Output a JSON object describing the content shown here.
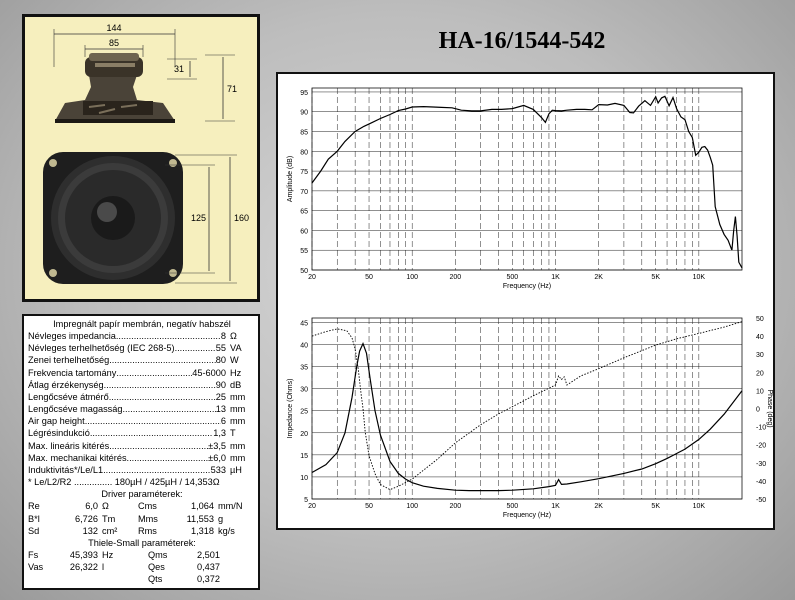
{
  "model": "HA-16/1544-542",
  "drawing": {
    "dim_144": "144",
    "dim_85": "85",
    "dim_31": "31",
    "dim_71": "71",
    "dim_125": "125",
    "dim_160": "160"
  },
  "specs": {
    "title": "Impregnált papír membrán, negatív habszél",
    "rows": [
      {
        "label": "Névleges impedancia",
        "value": "8",
        "unit": "Ω"
      },
      {
        "label": "Névleges terhelhetőség (IEC 268-5)",
        "value": "55",
        "unit": "VA"
      },
      {
        "label": "Zenei terhelhetőség",
        "value": "80",
        "unit": "W"
      },
      {
        "label": "Frekvencia tartomány",
        "value": "45-6000",
        "unit": "Hz"
      },
      {
        "label": "Átlag érzékenység",
        "value": "90",
        "unit": "dB"
      },
      {
        "label": "Lengőcséve átmérő",
        "value": "25",
        "unit": "mm"
      },
      {
        "label": "Lengőcséve magasság",
        "value": "13",
        "unit": "mm"
      },
      {
        "label": "Air gap height",
        "value": "6",
        "unit": "mm"
      },
      {
        "label": "Légrésindukció",
        "value": "1,3",
        "unit": "T"
      },
      {
        "label": "Max. lineáris kitérés",
        "value": "±3,5",
        "unit": "mm"
      },
      {
        "label": "Max. mechanikai kitérés",
        "value": "±6,0",
        "unit": "mm"
      },
      {
        "label": "Induktivitás*/Le/L1",
        "value": "533",
        "unit": "µH"
      }
    ],
    "le_note": "* Le/L2/R2 ............... 180µH / 425µH / 14,353Ω",
    "driver_title": "Driver paraméterek:",
    "driver_rows": [
      {
        "a_label": "Re",
        "a_value": "6,0",
        "a_unit": "Ω",
        "b_label": "Cms",
        "b_value": "1,064",
        "b_unit": "mm/N"
      },
      {
        "a_label": "B*l",
        "a_value": "6,726",
        "a_unit": "Tm",
        "b_label": "Mms",
        "b_value": "11,553",
        "b_unit": "g"
      },
      {
        "a_label": "Sd",
        "a_value": "132",
        "a_unit": "cm²",
        "b_label": "Rms",
        "b_value": "1,318",
        "b_unit": "kg/s"
      }
    ],
    "ts_title": "Thiele-Small paraméterek:",
    "ts_rows": [
      {
        "a_label": "Fs",
        "a_value": "45,393",
        "a_unit": "Hz",
        "b_label": "Qms",
        "b_value": "2,501"
      },
      {
        "a_label": "Vas",
        "a_value": "26,322",
        "a_unit": "l",
        "b_label": "Qes",
        "b_value": "0,437"
      },
      {
        "a_label": "",
        "a_value": "",
        "a_unit": "",
        "b_label": "Qts",
        "b_value": "0,372"
      }
    ]
  },
  "chart_data": [
    {
      "type": "line",
      "xscale": "log",
      "xlim": [
        20,
        20000
      ],
      "ylim": [
        50,
        96
      ],
      "xlabel": "Frequency (Hz)",
      "ylabel": "Amplitude (dB)",
      "xticks": [
        20,
        50,
        100,
        200,
        500,
        1000,
        2000,
        5000,
        10000
      ],
      "xticklabels": [
        "20",
        "50",
        "100",
        "200",
        "500",
        "1K",
        "2K",
        "5K",
        "10K"
      ],
      "yticks": [
        50,
        55,
        60,
        65,
        70,
        75,
        80,
        85,
        90,
        95
      ],
      "grid": true,
      "series": [
        {
          "color": "#000000",
          "x": [
            20,
            23,
            26,
            30,
            34,
            40,
            46,
            52,
            60,
            70,
            80,
            90,
            100,
            120,
            140,
            160,
            190,
            220,
            260,
            300,
            360,
            420,
            500,
            600,
            700,
            800,
            850,
            900,
            950,
            1000,
            1100,
            1200,
            1400,
            1600,
            1800,
            2000,
            2300,
            2600,
            3000,
            3300,
            3500,
            3800,
            4200,
            4600,
            5000,
            5200,
            5500,
            5800,
            6200,
            6600,
            7000,
            7500,
            8000,
            8500,
            9000,
            9500,
            10000,
            10500,
            11000,
            11500,
            12000,
            12500,
            13000,
            14000,
            15000,
            16000,
            17000,
            17500,
            18000,
            18500,
            19000,
            20000
          ],
          "y": [
            72,
            75,
            78,
            80,
            82.5,
            85,
            86.3,
            87.2,
            88.3,
            89.3,
            90.3,
            90.7,
            91.2,
            91.3,
            91.2,
            91.1,
            91,
            90.4,
            90.2,
            90.2,
            90.6,
            90.6,
            90.8,
            91.6,
            90.6,
            88.5,
            87.3,
            89.5,
            90.4,
            90.3,
            90.2,
            90.4,
            90.6,
            90.6,
            90.5,
            91.8,
            91.7,
            92.1,
            91.6,
            89.8,
            89.7,
            91.4,
            92.8,
            91.6,
            93.8,
            92.2,
            93.5,
            93.9,
            91.5,
            93.6,
            90.8,
            88.7,
            88,
            85,
            83.5,
            79,
            79.8,
            81,
            81.2,
            80.3,
            78.5,
            76.5,
            66,
            61.5,
            59,
            57.5,
            55,
            60,
            63.5,
            58.6,
            52,
            50.5
          ]
        }
      ]
    },
    {
      "type": "line",
      "xscale": "log",
      "xlim": [
        20,
        20000
      ],
      "ylim": [
        5,
        46
      ],
      "y2lim": [
        -50,
        50
      ],
      "xlabel": "Frequency (Hz)",
      "ylabel": "Impedance (Ohms)",
      "y2label": "Phase (deg)",
      "xticks": [
        20,
        50,
        100,
        200,
        500,
        1000,
        2000,
        5000,
        10000
      ],
      "xticklabels": [
        "20",
        "50",
        "100",
        "200",
        "500",
        "1K",
        "2K",
        "5K",
        "10K"
      ],
      "yticks": [
        5,
        10,
        15,
        20,
        25,
        30,
        35,
        40,
        45
      ],
      "y2ticks": [
        -50,
        -40,
        -30,
        -20,
        -10,
        0,
        10,
        20,
        30,
        40,
        50
      ],
      "grid": true,
      "series": [
        {
          "axis": "left",
          "color": "#000000",
          "x": [
            20,
            25,
            30,
            34,
            38,
            41,
            43,
            45.4,
            48,
            51,
            55,
            60,
            70,
            80,
            90,
            100,
            120,
            150,
            200,
            250,
            300,
            400,
            500,
            700,
            900,
            1000,
            1050,
            1100,
            1200,
            1500,
            2000,
            3000,
            4000,
            5000,
            6000,
            7000,
            8000,
            10000,
            12000,
            15000,
            20000
          ],
          "y": [
            11,
            12.8,
            15.5,
            20,
            28,
            35,
            38.5,
            40.2,
            38,
            32,
            25,
            19.5,
            13.5,
            10.8,
            9.5,
            8.7,
            7.9,
            7.4,
            7,
            6.9,
            6.9,
            6.9,
            7,
            7.3,
            7.8,
            8.1,
            9.4,
            8.3,
            8.4,
            8.9,
            9.6,
            10.8,
            11.8,
            13,
            14.2,
            15.3,
            16.3,
            18.5,
            20.8,
            24.2,
            29.5
          ]
        },
        {
          "axis": "right",
          "color": "#000000",
          "dash": true,
          "x": [
            20,
            25,
            30,
            35,
            38,
            40,
            42,
            44,
            45.4,
            47,
            50,
            55,
            60,
            70,
            80,
            100,
            150,
            200,
            300,
            400,
            500,
            700,
            1000,
            1050,
            1100,
            1150,
            1200,
            1500,
            2000,
            3000,
            5000,
            7000,
            10000,
            15000,
            20000
          ],
          "y": [
            40,
            42.5,
            44,
            43,
            39,
            33,
            22,
            8,
            0,
            -13,
            -26,
            -36,
            -42,
            -44.8,
            -43,
            -39,
            -28,
            -19,
            -9,
            -3,
            1,
            7,
            13,
            18,
            16,
            17.5,
            13,
            18,
            22,
            28,
            35,
            38.5,
            41.5,
            45,
            48
          ]
        }
      ]
    }
  ]
}
